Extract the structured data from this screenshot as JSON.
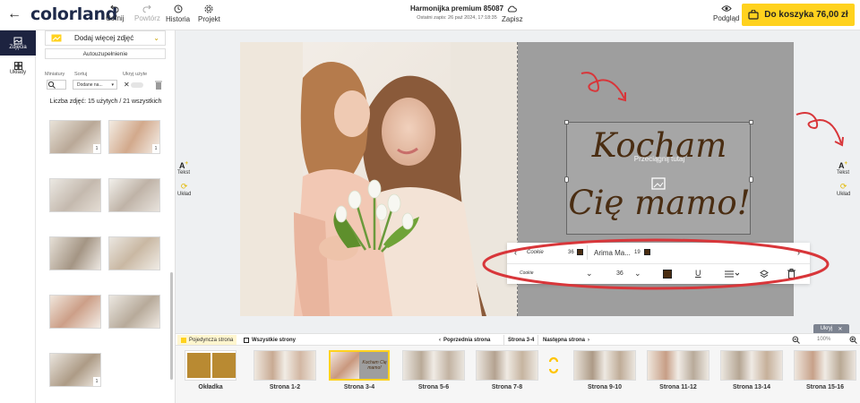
{
  "header": {
    "logo_text": "colorland",
    "back_label": "←",
    "undo_label": "Cofnij",
    "redo_label": "Powtórz",
    "history_label": "Historia",
    "project_label": "Projekt",
    "product_title": "Harmonijka premium 85087",
    "last_saved": "Ostatni zapis: 26 paź 2024, 17:18:35",
    "save_label": "Zapisz",
    "preview_label": "Podgląd",
    "cart_label": "Do koszyka  76,00 zł"
  },
  "rail": {
    "photos_label": "Zdjęcia",
    "layouts_label": "Układy"
  },
  "panel": {
    "add_photos_label": "Dodaj więcej zdjęć",
    "autofill_label": "Autouzupełnienie",
    "thumbnails_label": "Miniatury",
    "sort_label": "Sortuj",
    "hide_used_label": "Ukryj użyte",
    "sort_value": "Dodane na...",
    "photo_count": "Liczba zdjęć: 15 użytych / 21 wszystkich",
    "photo_badges": [
      "1",
      "1",
      "1",
      "1",
      "1",
      "1",
      "1",
      "1",
      "1"
    ]
  },
  "canvas": {
    "text_line1": "Kocham",
    "text_line2": "Cię mamo!",
    "drag_hint": "Przeciągnij tutaj",
    "left_text_btn": "Tekst",
    "left_layout_btn": "Układ",
    "right_text_btn": "Tekst",
    "right_layout_btn": "Układ"
  },
  "text_toolbar": {
    "font_small_1": "Cookie",
    "size_1": "36",
    "font_2": "Arima Ma...",
    "size_2": "19",
    "font_small_2": "Cookie",
    "size_3": "36",
    "underline": "U"
  },
  "bottom": {
    "hide_label": "Ukryj",
    "single_spread_tab": "Pojedyncza strona",
    "all_pages_tab": "Wszystkie strony",
    "prev_page": "Poprzednia strona",
    "current_page": "Strona 3-4",
    "next_page": "Następna strona",
    "zoom": "100%",
    "pages": [
      "Okładka",
      "Strona 1-2",
      "Strona 3-4",
      "Strona 5-6",
      "Strona 7-8",
      "Strona 9-10",
      "Strona 11-12",
      "Strona 13-14",
      "Strona 15-16"
    ],
    "thumb_text": "Kocham Cię mamo!"
  },
  "colors": {
    "accent_yellow": "#ffd21e",
    "rail_active": "#1d2340",
    "annotation_red": "#d8363a",
    "text_brown": "#4a2d12"
  }
}
